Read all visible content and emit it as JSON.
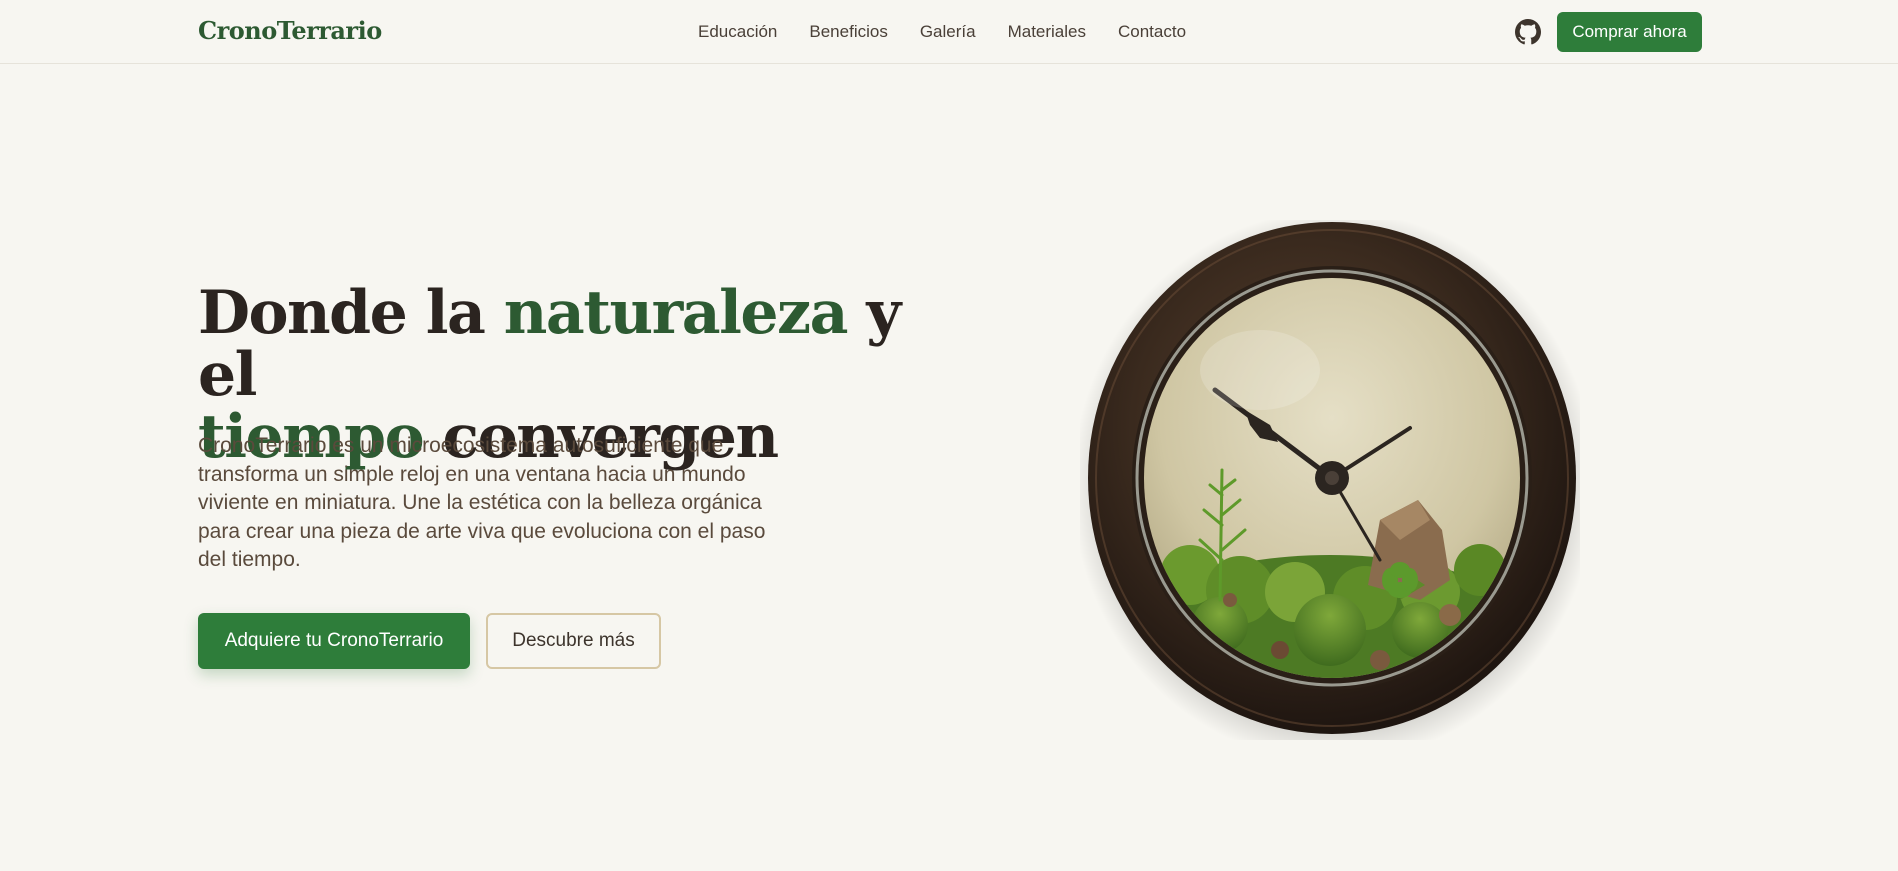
{
  "header": {
    "brand": "CronoTerrario",
    "nav": [
      "Educación",
      "Beneficios",
      "Galería",
      "Materiales",
      "Contacto"
    ],
    "github_icon": "github-icon",
    "cta_label": "Comprar ahora"
  },
  "hero": {
    "title_parts": [
      "Donde la ",
      "naturaleza",
      " y el",
      "tiempo",
      " convergen"
    ],
    "description": "CronoTerrario es un microecosistema autosuficiente que transforma un simple reloj en una ventana hacia un mundo viviente en miniatura. Une la estética con la belleza orgánica para crear una pieza de arte viva que evoluciona con el paso del tiempo.",
    "primary_button": "Adquiere tu CronoTerrario",
    "secondary_button": "Descubre más"
  },
  "colors": {
    "accent": "#2e7d3a",
    "title_green": "#2d5a32",
    "background": "#f7f6f1"
  }
}
